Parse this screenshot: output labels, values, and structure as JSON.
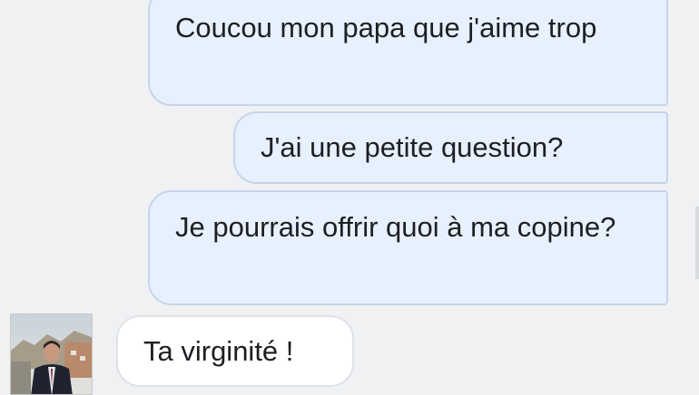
{
  "conversation": {
    "messages": [
      {
        "direction": "sent",
        "text": "Coucou mon papa que j'aime trop"
      },
      {
        "direction": "sent",
        "text": "J'ai une petite question?"
      },
      {
        "direction": "sent",
        "text": "Je pourrais offrir quoi à ma copine?"
      },
      {
        "direction": "received",
        "text": "Ta virginité !"
      }
    ]
  },
  "colors": {
    "background": "#f0f1f3",
    "sent_bubble": "#e7f0fd",
    "sent_border": "#c5d5ea",
    "received_bubble": "#ffffff",
    "text": "#1d1f22"
  },
  "icons": {
    "avatar": "contact-photo"
  }
}
